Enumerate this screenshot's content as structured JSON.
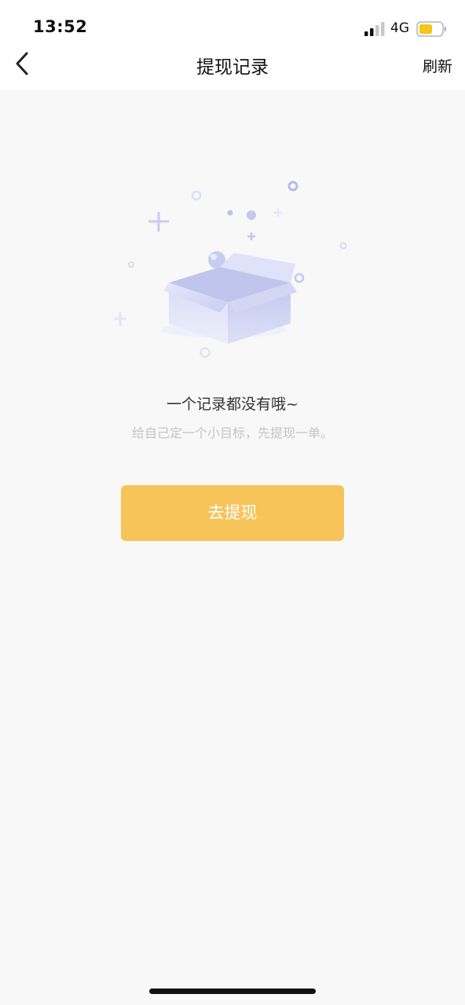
{
  "status_bar": {
    "time": "13:52",
    "network": "4G",
    "signal_icon": "signal-bars-icon",
    "battery_icon": "battery-icon",
    "battery_color": "#f5c518"
  },
  "nav": {
    "back_icon": "chevron-left-icon",
    "title": "提现记录",
    "refresh_label": "刷新"
  },
  "empty_state": {
    "illustration": "empty-box-icon",
    "title": "一个记录都没有哦~",
    "subtitle": "给自己定一个小目标，先提现一单。",
    "button_label": "去提现",
    "button_color": "#f7c45a"
  }
}
